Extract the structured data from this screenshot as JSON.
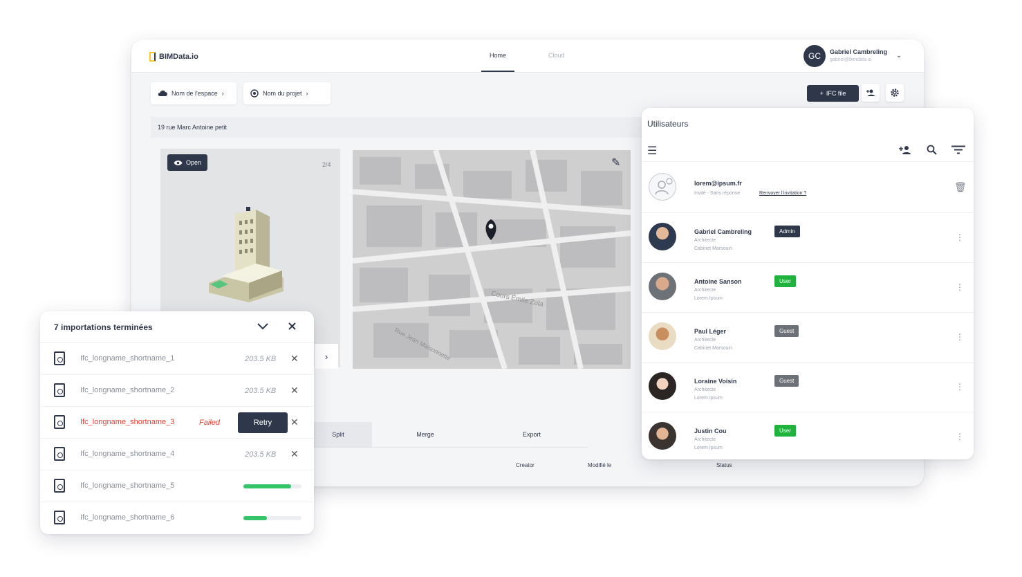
{
  "app": {
    "logo": "BIMData.io",
    "tabs": [
      {
        "label": "Home",
        "active": true
      },
      {
        "label": "Cloud",
        "active": false
      }
    ],
    "user": {
      "initials": "GC",
      "name": "Gabriel Cambreling",
      "email": "gabriel@bimdata.io"
    },
    "breadcrumb": [
      {
        "label": "Nom de l'espace"
      },
      {
        "label": "Nom du projet"
      }
    ],
    "ifc_button": "IFC file",
    "address": "19 rue Marc Antoine petit",
    "viewer": {
      "open_label": "Open",
      "count": "2/4"
    },
    "map_labels": [
      "Cours Émile Zola",
      "Rue Jean Maisonnette"
    ],
    "bottom_tabs": [
      {
        "label": "Split"
      },
      {
        "label": "Merge"
      },
      {
        "label": "Export"
      }
    ],
    "table_headers": [
      "Creator",
      "Modifié le",
      "Status"
    ],
    "colors": {
      "primary": "#2f374a",
      "success": "#1fb33e",
      "guest": "#6c7077",
      "error": "#ef3b2e",
      "accent": "#f9c72b"
    }
  },
  "users_panel": {
    "title": "Utilisateurs",
    "users": [
      {
        "name": "lorem@ipsum.fr",
        "sub1": "Invité - Sans réponse",
        "link": "Renvoyer l'invitation ?",
        "role": "",
        "pending": true
      },
      {
        "name": "Gabriel Cambreling",
        "sub1": "Architecte",
        "sub2": "Cabinet Marsouin",
        "role": "Admin"
      },
      {
        "name": "Antoine Sanson",
        "sub1": "Architecte",
        "sub2": "Lorem Ipsum",
        "role": "User"
      },
      {
        "name": "Paul Léger",
        "sub1": "Architecte",
        "sub2": "Cabinet Marsouin",
        "role": "Guest"
      },
      {
        "name": "Loraine Voisin",
        "sub1": "Architecte",
        "sub2": "Lorem Ipsum",
        "role": "Guest"
      },
      {
        "name": "Justin Cou",
        "sub1": "Architecte",
        "sub2": "Lorem Ipsum",
        "role": "User"
      }
    ]
  },
  "imports_panel": {
    "title": "7 importations terminées",
    "files": [
      {
        "name": "Ifc_longname_shortname_1",
        "size": "203.5 KB",
        "status": "done"
      },
      {
        "name": "Ifc_longname_shortname_2",
        "size": "203.5 KB",
        "status": "done"
      },
      {
        "name": "Ifc_longname_shortname_3",
        "size": "",
        "status": "failed",
        "status_label": "Failed",
        "retry_label": "Retry"
      },
      {
        "name": "Ifc_longname_shortname_4",
        "size": "203.5 KB",
        "status": "done"
      },
      {
        "name": "Ifc_longname_shortname_5",
        "size": "",
        "status": "uploading",
        "progress": 0.82
      },
      {
        "name": "Ifc_longname_shortname_6",
        "size": "",
        "status": "uploading",
        "progress": 0.4
      }
    ]
  }
}
